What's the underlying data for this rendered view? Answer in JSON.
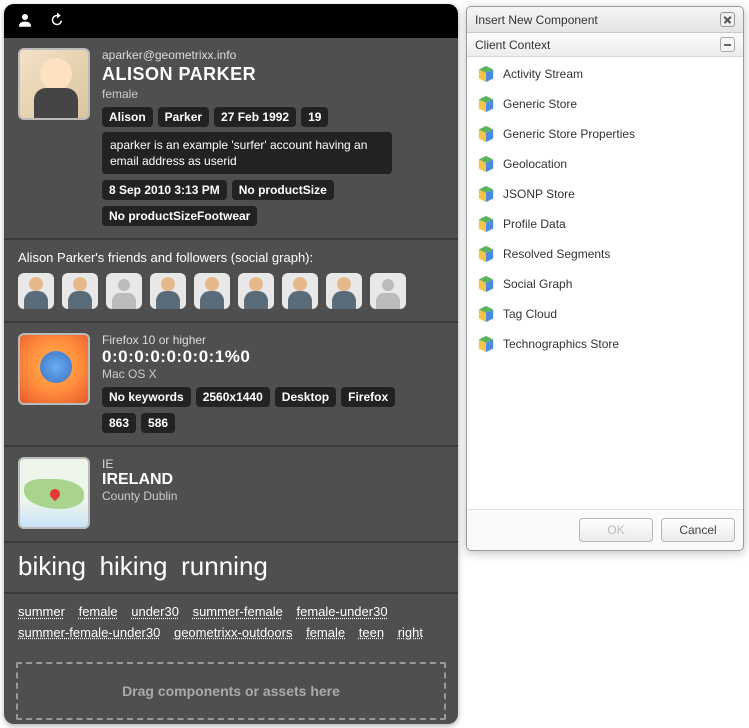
{
  "profile": {
    "email": "aparker@geometrixx.info",
    "display_name": "ALISON PARKER",
    "gender": "female",
    "chips": [
      "Alison",
      "Parker",
      "27 Feb 1992",
      "19"
    ],
    "note": "aparker is an example 'surfer' account having an email address as userid",
    "chips2": [
      "8 Sep 2010 3:13 PM",
      "No productSize"
    ],
    "chips3": [
      "No productSizeFootwear"
    ]
  },
  "social": {
    "title": "Alison Parker's friends and followers (social graph):"
  },
  "techno": {
    "ua": "Firefox 10 or higher",
    "ip": "0:0:0:0:0:0:0:1%0",
    "os": "Mac OS X",
    "chips": [
      "No keywords",
      "2560x1440",
      "Desktop",
      "Firefox"
    ],
    "chips2": [
      "863",
      "586"
    ]
  },
  "geo": {
    "cc": "IE",
    "country": "IRELAND",
    "region": "County Dublin"
  },
  "tags": [
    "biking",
    "hiking",
    "running"
  ],
  "segments": [
    "summer",
    "female",
    "under30",
    "summer-female",
    "female-under30",
    "summer-female-under30",
    "geometrixx-outdoors",
    "female",
    "teen",
    "right"
  ],
  "dropzone": "Drag components or assets here",
  "dialog": {
    "title": "Insert New Component",
    "group": "Client Context",
    "items": [
      "Activity Stream",
      "Generic Store",
      "Generic Store Properties",
      "Geolocation",
      "JSONP Store",
      "Profile Data",
      "Resolved Segments",
      "Social Graph",
      "Tag Cloud",
      "Technographics Store"
    ],
    "ok": "OK",
    "cancel": "Cancel"
  }
}
